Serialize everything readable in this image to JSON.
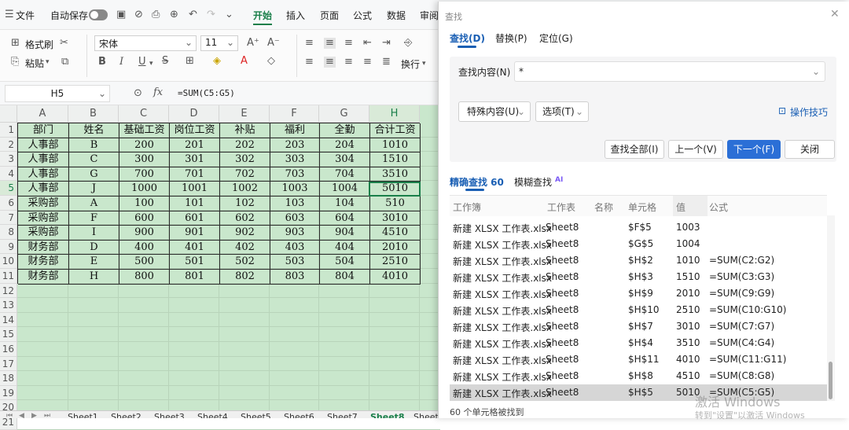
{
  "menubar": {
    "file": "文件",
    "autosave": "自动保存",
    "tabs": [
      "开始",
      "插入",
      "页面",
      "公式",
      "数据",
      "审阅"
    ],
    "active_tab": "开始"
  },
  "ribbon": {
    "format_painter": "格式刷",
    "paste": "粘贴",
    "font_name": "宋体",
    "font_size": "11",
    "wrap": "换行"
  },
  "formula_bar": {
    "name_box": "H5",
    "fx": "fx",
    "formula": "=SUM(C5:G5)"
  },
  "sheet": {
    "columns": [
      "A",
      "B",
      "C",
      "D",
      "E",
      "F",
      "G",
      "H"
    ],
    "row_numbers": [
      "1",
      "2",
      "3",
      "4",
      "5",
      "6",
      "7",
      "8",
      "9",
      "10",
      "11",
      "12",
      "13",
      "14",
      "15",
      "16",
      "17",
      "18",
      "19",
      "20",
      "21"
    ],
    "rows": [
      [
        "部门",
        "姓名",
        "基础工资",
        "岗位工资",
        "补贴",
        "福利",
        "全勤",
        "合计工资"
      ],
      [
        "人事部",
        "B",
        "200",
        "201",
        "202",
        "203",
        "204",
        "1010"
      ],
      [
        "人事部",
        "C",
        "300",
        "301",
        "302",
        "303",
        "304",
        "1510"
      ],
      [
        "人事部",
        "G",
        "700",
        "701",
        "702",
        "703",
        "704",
        "3510"
      ],
      [
        "人事部",
        "J",
        "1000",
        "1001",
        "1002",
        "1003",
        "1004",
        "5010"
      ],
      [
        "采购部",
        "A",
        "100",
        "101",
        "102",
        "103",
        "104",
        "510"
      ],
      [
        "采购部",
        "F",
        "600",
        "601",
        "602",
        "603",
        "604",
        "3010"
      ],
      [
        "采购部",
        "I",
        "900",
        "901",
        "902",
        "903",
        "904",
        "4510"
      ],
      [
        "财务部",
        "D",
        "400",
        "401",
        "402",
        "403",
        "404",
        "2010"
      ],
      [
        "财务部",
        "E",
        "500",
        "501",
        "502",
        "503",
        "504",
        "2510"
      ],
      [
        "财务部",
        "H",
        "800",
        "801",
        "802",
        "803",
        "804",
        "4010"
      ]
    ],
    "sheet_tabs": [
      "Sheet1",
      "Sheet2",
      "Sheet3",
      "Sheet4",
      "Sheet5",
      "Sheet6",
      "Sheet7",
      "Sheet8",
      "Sheet"
    ],
    "active_sheet": "Sheet8"
  },
  "dialog": {
    "title": "查找",
    "tabs": [
      "查找(D)",
      "替换(P)",
      "定位(G)"
    ],
    "find_label": "查找内容(N)",
    "find_value": "*",
    "special_btn": "特殊内容(U)",
    "options_btn": "选项(T)",
    "tips_link": "操作技巧",
    "btn_find_all": "查找全部(I)",
    "btn_prev": "上一个(V)",
    "btn_next": "下一个(F)",
    "btn_close": "关闭",
    "mode_exact": "精确查找 60",
    "mode_fuzzy": "模糊查找",
    "ai_badge": "AI",
    "headers": [
      "工作簿",
      "工作表",
      "名称",
      "单元格",
      "值",
      "公式"
    ],
    "results": [
      {
        "book": "新建 XLSX 工作表.xlsx",
        "sheet": "Sheet8",
        "cell": "$F$5",
        "value": "1003",
        "formula": ""
      },
      {
        "book": "新建 XLSX 工作表.xlsx",
        "sheet": "Sheet8",
        "cell": "$G$5",
        "value": "1004",
        "formula": ""
      },
      {
        "book": "新建 XLSX 工作表.xlsx",
        "sheet": "Sheet8",
        "cell": "$H$2",
        "value": "1010",
        "formula": "=SUM(C2:G2)"
      },
      {
        "book": "新建 XLSX 工作表.xlsx",
        "sheet": "Sheet8",
        "cell": "$H$3",
        "value": "1510",
        "formula": "=SUM(C3:G3)"
      },
      {
        "book": "新建 XLSX 工作表.xlsx",
        "sheet": "Sheet8",
        "cell": "$H$9",
        "value": "2010",
        "formula": "=SUM(C9:G9)"
      },
      {
        "book": "新建 XLSX 工作表.xlsx",
        "sheet": "Sheet8",
        "cell": "$H$10",
        "value": "2510",
        "formula": "=SUM(C10:G10)"
      },
      {
        "book": "新建 XLSX 工作表.xlsx",
        "sheet": "Sheet8",
        "cell": "$H$7",
        "value": "3010",
        "formula": "=SUM(C7:G7)"
      },
      {
        "book": "新建 XLSX 工作表.xlsx",
        "sheet": "Sheet8",
        "cell": "$H$4",
        "value": "3510",
        "formula": "=SUM(C4:G4)"
      },
      {
        "book": "新建 XLSX 工作表.xlsx",
        "sheet": "Sheet8",
        "cell": "$H$11",
        "value": "4010",
        "formula": "=SUM(C11:G11)"
      },
      {
        "book": "新建 XLSX 工作表.xlsx",
        "sheet": "Sheet8",
        "cell": "$H$8",
        "value": "4510",
        "formula": "=SUM(C8:G8)"
      },
      {
        "book": "新建 XLSX 工作表.xlsx",
        "sheet": "Sheet8",
        "cell": "$H$5",
        "value": "5010",
        "formula": "=SUM(C5:G5)"
      }
    ],
    "status": "60 个单元格被找到",
    "watermark1": "激活 Windows",
    "watermark2": "转到\"设置\"以激活 Windows"
  },
  "colors": {
    "accent": "#1a7f4a",
    "button_primary": "#2b6fd6",
    "dialog_tab": "#1a5fb4",
    "sheet_bg": "#c9e7cc"
  }
}
